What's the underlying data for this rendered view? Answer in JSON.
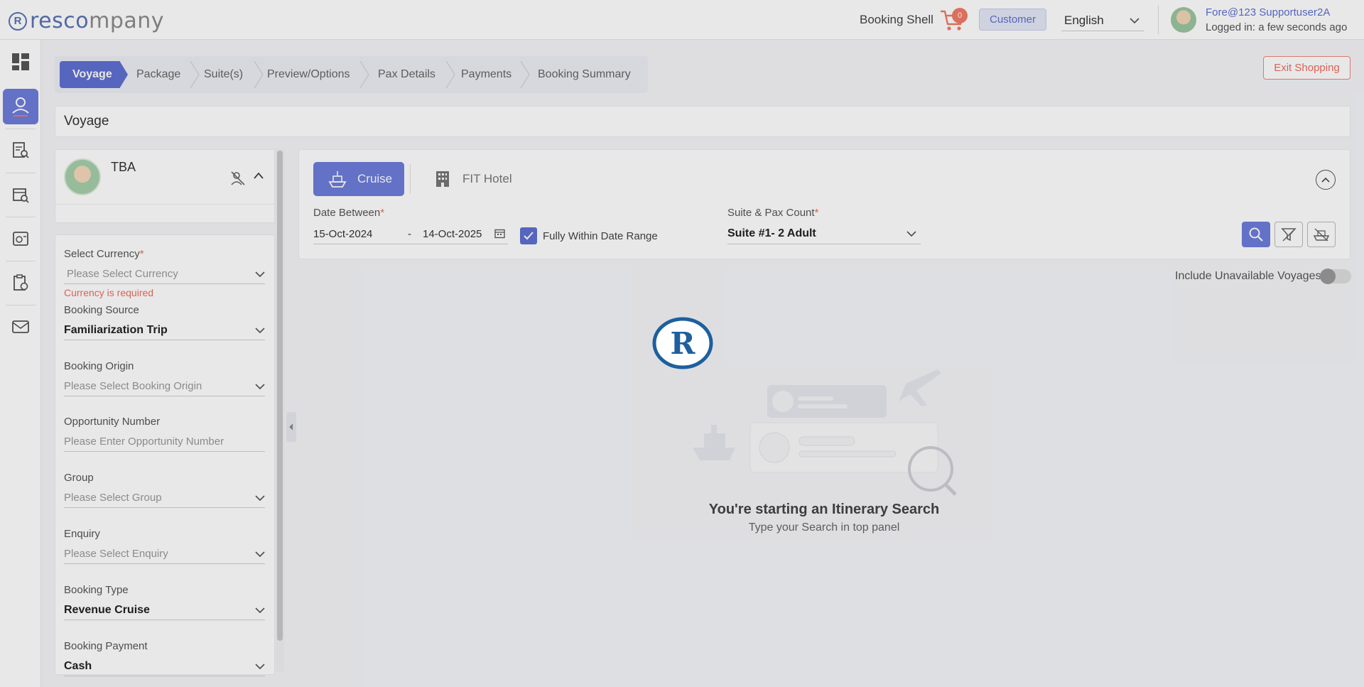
{
  "header": {
    "logo_part1": "resco",
    "logo_part2": "mpany",
    "booking_shell": "Booking Shell",
    "cart_count": "0",
    "customer_label": "Customer",
    "language": "English",
    "user_name": "Fore@123 Supportuser2A",
    "login_status": "Logged in: a few seconds ago"
  },
  "nav": {
    "items": [
      "dashboard-icon",
      "user-icon",
      "document-search-icon",
      "calendar-search-icon",
      "report-icon",
      "clipboard-icon",
      "mail-icon"
    ]
  },
  "steps": [
    "Voyage",
    "Package",
    "Suite(s)",
    "Preview/Options",
    "Pax Details",
    "Payments",
    "Booking Summary"
  ],
  "exit_label": "Exit Shopping",
  "section_title": "Voyage",
  "profile": {
    "name": "TBA"
  },
  "form": {
    "currency_label": "Select Currency",
    "currency_placeholder": "Please Select Currency",
    "currency_error": "Currency is required",
    "source_label": "Booking Source",
    "source_value": "Familiarization Trip",
    "origin_label": "Booking Origin",
    "origin_placeholder": "Please Select Booking Origin",
    "opportunity_label": "Opportunity Number",
    "opportunity_placeholder": "Please Enter Opportunity Number",
    "group_label": "Group",
    "group_placeholder": "Please Select Group",
    "enquiry_label": "Enquiry",
    "enquiry_placeholder": "Please Select Enquiry",
    "type_label": "Booking Type",
    "type_value": "Revenue Cruise",
    "payment_label": "Booking Payment",
    "payment_value": "Cash"
  },
  "search": {
    "cruise_label": "Cruise",
    "hotel_label": "FIT Hotel",
    "date_label": "Date Between",
    "date_from": "15-Oct-2024",
    "date_sep": "-",
    "date_to": "14-Oct-2025",
    "within_label": "Fully Within Date Range",
    "within_checked": true,
    "pax_label": "Suite & Pax Count",
    "pax_value": "Suite #1- 2 Adult",
    "include_label": "Include Unavailable Voyages"
  },
  "empty_state": {
    "title": "You're starting an Itinerary Search",
    "subtitle": "Type your Search in top panel"
  },
  "loader_letter": "R",
  "colors": {
    "accent": "#5f6fd1",
    "error": "#ef6d60"
  }
}
